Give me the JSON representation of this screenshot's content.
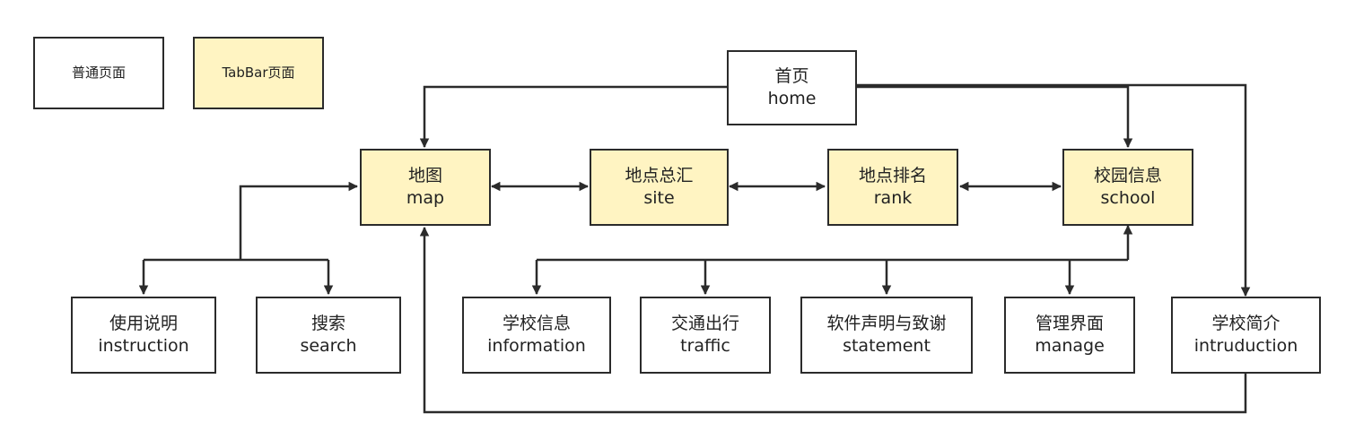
{
  "colors": {
    "normal_fill": "#ffffff",
    "tabbar_fill": "#fff4c2",
    "stroke": "#2b2b2b"
  },
  "legend": {
    "normal": "普通页面",
    "tabbar": "TabBar页面"
  },
  "nodes": {
    "home": {
      "title": "首页",
      "sub": "home"
    },
    "map": {
      "title": "地图",
      "sub": "map"
    },
    "site": {
      "title": "地点总汇",
      "sub": "site"
    },
    "rank": {
      "title": "地点排名",
      "sub": "rank"
    },
    "school": {
      "title": "校园信息",
      "sub": "school"
    },
    "instruction": {
      "title": "使用说明",
      "sub": "instruction"
    },
    "search": {
      "title": "搜索",
      "sub": "search"
    },
    "information": {
      "title": "学校信息",
      "sub": "information"
    },
    "traffic": {
      "title": "交通出行",
      "sub": "traffic"
    },
    "statement": {
      "title": "软件声明与致谢",
      "sub": "statement"
    },
    "manage": {
      "title": "管理界面",
      "sub": "manage"
    },
    "intruduction": {
      "title": "学校简介",
      "sub": "intruduction"
    }
  },
  "edges": [
    {
      "from": "home",
      "to": "map",
      "type": "directed"
    },
    {
      "from": "home",
      "to": "school",
      "type": "directed"
    },
    {
      "from": "home",
      "to": "intruduction",
      "type": "directed"
    },
    {
      "from": "map",
      "to": "site",
      "type": "bidirectional"
    },
    {
      "from": "site",
      "to": "rank",
      "type": "bidirectional"
    },
    {
      "from": "rank",
      "to": "school",
      "type": "bidirectional"
    },
    {
      "from": "map",
      "to": "instruction",
      "type": "bidirectional"
    },
    {
      "from": "map",
      "to": "search",
      "type": "bidirectional"
    },
    {
      "from": "school",
      "to": "information",
      "type": "bidirectional"
    },
    {
      "from": "school",
      "to": "traffic",
      "type": "bidirectional"
    },
    {
      "from": "school",
      "to": "statement",
      "type": "bidirectional"
    },
    {
      "from": "school",
      "to": "manage",
      "type": "bidirectional"
    },
    {
      "from": "intruduction",
      "to": "map",
      "type": "directed"
    }
  ]
}
